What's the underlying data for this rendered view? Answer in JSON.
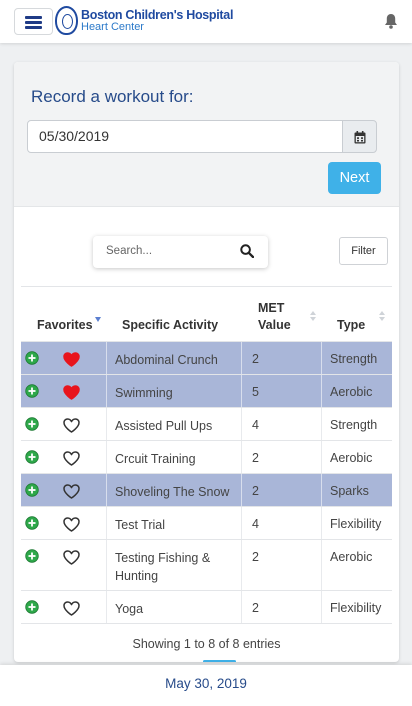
{
  "header": {
    "brand_title": "Boston Children's Hospital",
    "brand_subtitle": "Heart Center"
  },
  "record": {
    "label": "Record a workout for:",
    "date_value": "05/30/2019",
    "next_label": "Next"
  },
  "search": {
    "placeholder": "Search..."
  },
  "filter_label": "Filter",
  "table": {
    "columns": {
      "favorites": "Favorites",
      "activity": "Specific Activity",
      "met_line1": "MET",
      "met_line2": "Value",
      "type": "Type"
    },
    "rows": [
      {
        "activity": "Abdominal Crunch",
        "met": "2",
        "type": "Strength",
        "favorite": true,
        "selected": true
      },
      {
        "activity": "Swimming",
        "met": "5",
        "type": "Aerobic",
        "favorite": true,
        "selected": true
      },
      {
        "activity": "Assisted Pull Ups",
        "met": "4",
        "type": "Strength",
        "favorite": false,
        "selected": false
      },
      {
        "activity": "Crcuit Training",
        "met": "2",
        "type": "Aerobic",
        "favorite": false,
        "selected": false
      },
      {
        "activity": "Shoveling The Snow",
        "met": "2",
        "type": "Sparks",
        "favorite": false,
        "selected": true
      },
      {
        "activity": "Test Trial",
        "met": "4",
        "type": "Flexibility",
        "favorite": false,
        "selected": false
      },
      {
        "activity": "Testing Fishing & Hunting",
        "met": "2",
        "type": "Aerobic",
        "favorite": false,
        "selected": false
      },
      {
        "activity": "Yoga",
        "met": "2",
        "type": "Flexibility",
        "favorite": false,
        "selected": false
      }
    ],
    "info": "Showing 1 to 8 of 8 entries"
  },
  "footer": {
    "date": "May 30, 2019"
  },
  "colors": {
    "brand_blue": "#1f4aa0",
    "accent": "#3fb1e8",
    "selected_row": "#a9b6d8",
    "heart_red": "#e8141c",
    "add_green": "#2ea84a"
  },
  "icons": [
    "hamburger-menu-icon",
    "hospital-seal-logo",
    "bell-icon",
    "calendar-icon",
    "search-icon",
    "add-circle-icon",
    "heart-icon"
  ]
}
